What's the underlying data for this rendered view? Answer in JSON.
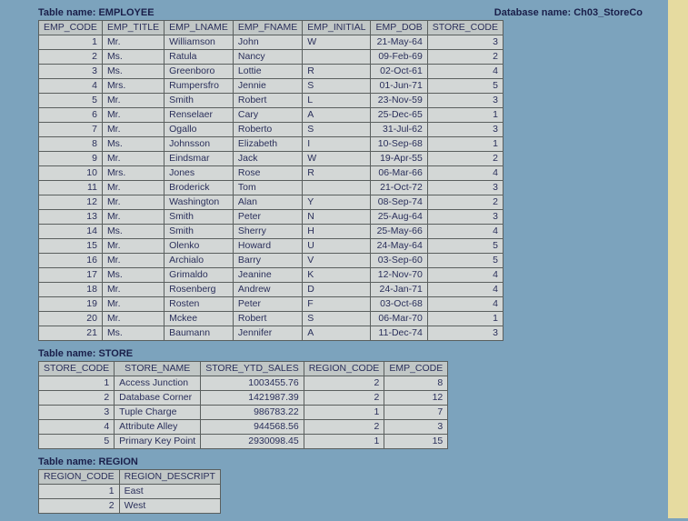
{
  "labels": {
    "table_name_prefix": "Table name: ",
    "db_name_prefix": "Database name: ",
    "db_name": "Ch03_StoreCo"
  },
  "employee": {
    "title": "EMPLOYEE",
    "columns": [
      "EMP_CODE",
      "EMP_TITLE",
      "EMP_LNAME",
      "EMP_FNAME",
      "EMP_INITIAL",
      "EMP_DOB",
      "STORE_CODE"
    ],
    "rows": [
      {
        "code": "1",
        "title": "Mr.",
        "lname": "Williamson",
        "fname": "John",
        "initial": "W",
        "dob": "21-May-64",
        "store": "3"
      },
      {
        "code": "2",
        "title": "Ms.",
        "lname": "Ratula",
        "fname": "Nancy",
        "initial": "",
        "dob": "09-Feb-69",
        "store": "2"
      },
      {
        "code": "3",
        "title": "Ms.",
        "lname": "Greenboro",
        "fname": "Lottie",
        "initial": "R",
        "dob": "02-Oct-61",
        "store": "4"
      },
      {
        "code": "4",
        "title": "Mrs.",
        "lname": "Rumpersfro",
        "fname": "Jennie",
        "initial": "S",
        "dob": "01-Jun-71",
        "store": "5"
      },
      {
        "code": "5",
        "title": "Mr.",
        "lname": "Smith",
        "fname": "Robert",
        "initial": "L",
        "dob": "23-Nov-59",
        "store": "3"
      },
      {
        "code": "6",
        "title": "Mr.",
        "lname": "Renselaer",
        "fname": "Cary",
        "initial": "A",
        "dob": "25-Dec-65",
        "store": "1"
      },
      {
        "code": "7",
        "title": "Mr.",
        "lname": "Ogallo",
        "fname": "Roberto",
        "initial": "S",
        "dob": "31-Jul-62",
        "store": "3"
      },
      {
        "code": "8",
        "title": "Ms.",
        "lname": "Johnsson",
        "fname": "Elizabeth",
        "initial": "I",
        "dob": "10-Sep-68",
        "store": "1"
      },
      {
        "code": "9",
        "title": "Mr.",
        "lname": "Eindsmar",
        "fname": "Jack",
        "initial": "W",
        "dob": "19-Apr-55",
        "store": "2"
      },
      {
        "code": "10",
        "title": "Mrs.",
        "lname": "Jones",
        "fname": "Rose",
        "initial": "R",
        "dob": "06-Mar-66",
        "store": "4"
      },
      {
        "code": "11",
        "title": "Mr.",
        "lname": "Broderick",
        "fname": "Tom",
        "initial": "",
        "dob": "21-Oct-72",
        "store": "3"
      },
      {
        "code": "12",
        "title": "Mr.",
        "lname": "Washington",
        "fname": "Alan",
        "initial": "Y",
        "dob": "08-Sep-74",
        "store": "2"
      },
      {
        "code": "13",
        "title": "Mr.",
        "lname": "Smith",
        "fname": "Peter",
        "initial": "N",
        "dob": "25-Aug-64",
        "store": "3"
      },
      {
        "code": "14",
        "title": "Ms.",
        "lname": "Smith",
        "fname": "Sherry",
        "initial": "H",
        "dob": "25-May-66",
        "store": "4"
      },
      {
        "code": "15",
        "title": "Mr.",
        "lname": "Olenko",
        "fname": "Howard",
        "initial": "U",
        "dob": "24-May-64",
        "store": "5"
      },
      {
        "code": "16",
        "title": "Mr.",
        "lname": "Archialo",
        "fname": "Barry",
        "initial": "V",
        "dob": "03-Sep-60",
        "store": "5"
      },
      {
        "code": "17",
        "title": "Ms.",
        "lname": "Grimaldo",
        "fname": "Jeanine",
        "initial": "K",
        "dob": "12-Nov-70",
        "store": "4"
      },
      {
        "code": "18",
        "title": "Mr.",
        "lname": "Rosenberg",
        "fname": "Andrew",
        "initial": "D",
        "dob": "24-Jan-71",
        "store": "4"
      },
      {
        "code": "19",
        "title": "Mr.",
        "lname": "Rosten",
        "fname": "Peter",
        "initial": "F",
        "dob": "03-Oct-68",
        "store": "4"
      },
      {
        "code": "20",
        "title": "Mr.",
        "lname": "Mckee",
        "fname": "Robert",
        "initial": "S",
        "dob": "06-Mar-70",
        "store": "1"
      },
      {
        "code": "21",
        "title": "Ms.",
        "lname": "Baumann",
        "fname": "Jennifer",
        "initial": "A",
        "dob": "11-Dec-74",
        "store": "3"
      }
    ]
  },
  "store": {
    "title": "STORE",
    "columns": [
      "STORE_CODE",
      "STORE_NAME",
      "STORE_YTD_SALES",
      "REGION_CODE",
      "EMP_CODE"
    ],
    "rows": [
      {
        "code": "1",
        "name": "Access Junction",
        "ytd": "1003455.76",
        "region": "2",
        "emp": "8"
      },
      {
        "code": "2",
        "name": "Database Corner",
        "ytd": "1421987.39",
        "region": "2",
        "emp": "12"
      },
      {
        "code": "3",
        "name": "Tuple Charge",
        "ytd": "986783.22",
        "region": "1",
        "emp": "7"
      },
      {
        "code": "4",
        "name": "Attribute Alley",
        "ytd": "944568.56",
        "region": "2",
        "emp": "3"
      },
      {
        "code": "5",
        "name": "Primary Key Point",
        "ytd": "2930098.45",
        "region": "1",
        "emp": "15"
      }
    ]
  },
  "region": {
    "title": "REGION",
    "columns": [
      "REGION_CODE",
      "REGION_DESCRIPT"
    ],
    "rows": [
      {
        "code": "1",
        "desc": "East"
      },
      {
        "code": "2",
        "desc": "West"
      }
    ]
  }
}
